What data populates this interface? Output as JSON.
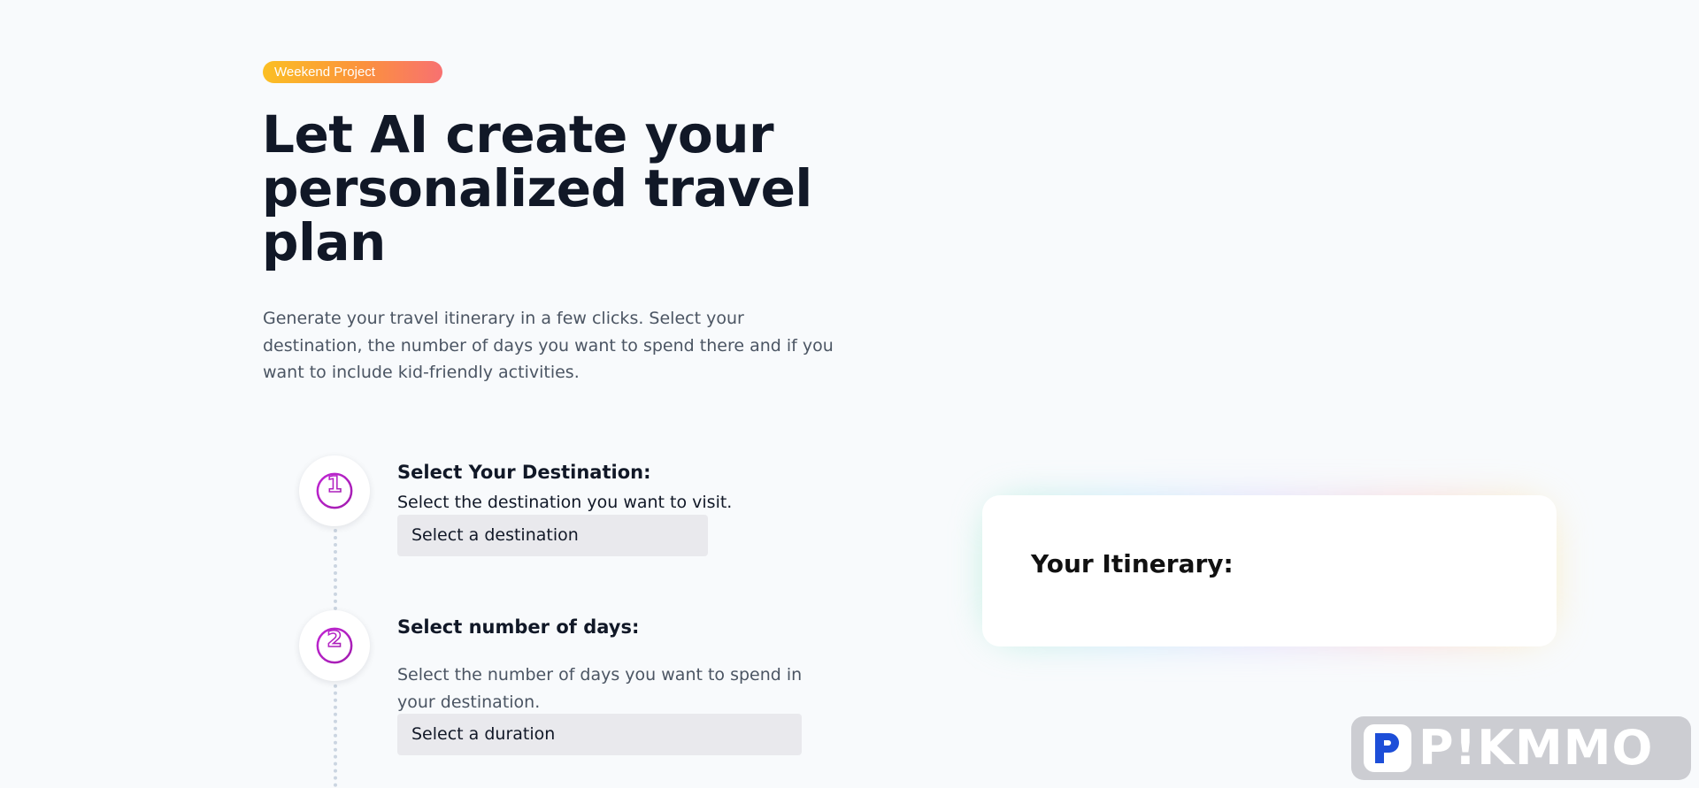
{
  "hero": {
    "badge": "Weekend Project",
    "headline": "Let AI create your personalized travel plan",
    "subtitle": "Generate your travel itinerary in a few clicks. Select your destination, the number of days you want to spend there and if you want to include kid-friendly activities."
  },
  "steps": [
    {
      "number": "1",
      "icon": "number-1-circle-icon",
      "title": "Select Your Destination:",
      "description": "Select the destination you want to visit.",
      "select_value": "Select a destination"
    },
    {
      "number": "2",
      "icon": "number-2-circle-icon",
      "title": "Select number of days:",
      "description": "Select the number of days you want to spend in your destination.",
      "select_value": "Select a duration"
    }
  ],
  "itinerary": {
    "title": "Your Itinerary:"
  },
  "watermark": {
    "text": "P!KMMO",
    "icon": "pikmmo-logo-icon"
  },
  "colors": {
    "badge_gradient": [
      "#fbbf24",
      "#fb923c",
      "#f87171"
    ],
    "step_icon_gradient": [
      "#c026d3",
      "#a21caf"
    ],
    "background": "#f8fafc",
    "select_background": "#e9e9ed",
    "logo_blue": "#1d4ed8"
  }
}
